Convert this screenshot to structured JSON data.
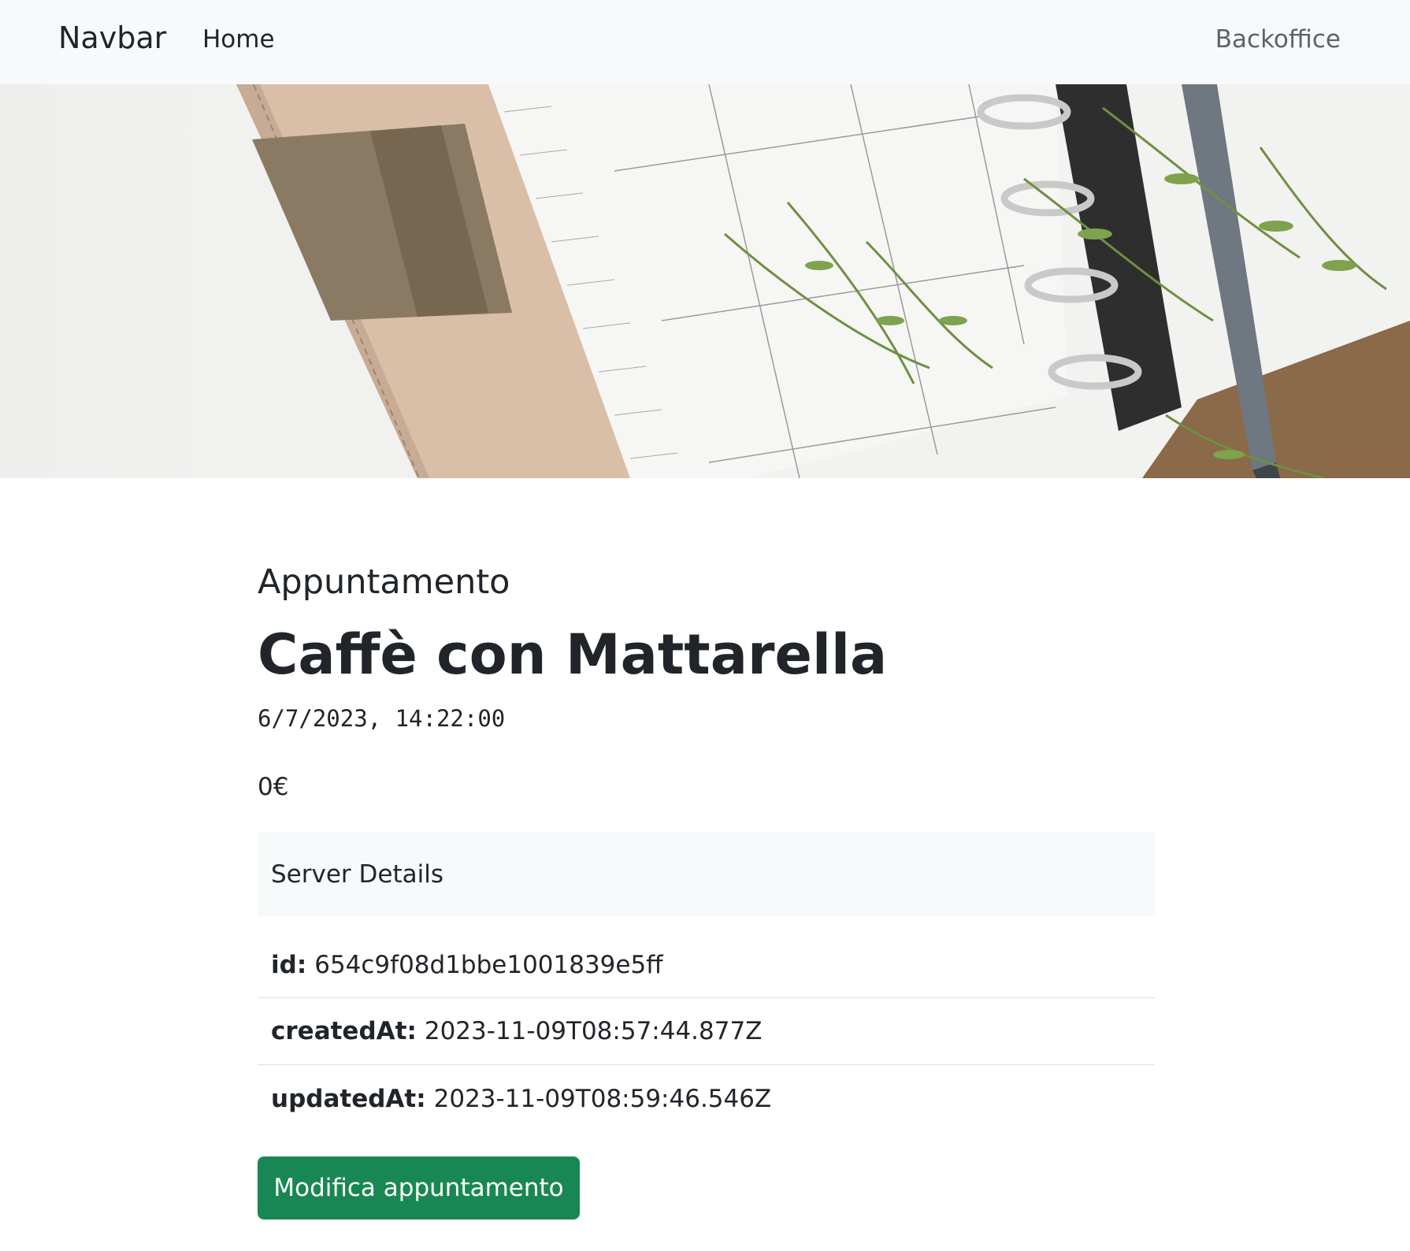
{
  "navbar": {
    "brand": "Navbar",
    "home_label": "Home",
    "backoffice_label": "Backoffice"
  },
  "hero": {
    "image_alt": "planner with plant and pen"
  },
  "appointment": {
    "subtitle": "Appuntamento",
    "title": "Caffè con Mattarella",
    "datetime": "6/7/2023, 14:22:00",
    "price": "0€"
  },
  "server_details": {
    "header": "Server Details",
    "rows": [
      {
        "key": "id:",
        "value": "654c9f08d1bbe1001839e5ff"
      },
      {
        "key": "createdAt:",
        "value": "2023-11-09T08:57:44.877Z"
      },
      {
        "key": "updatedAt:",
        "value": "2023-11-09T08:59:46.546Z"
      }
    ]
  },
  "actions": {
    "edit_label": "Modifica appuntamento"
  },
  "colors": {
    "accent": "#198754",
    "navbar_bg": "#f8f9fa"
  }
}
